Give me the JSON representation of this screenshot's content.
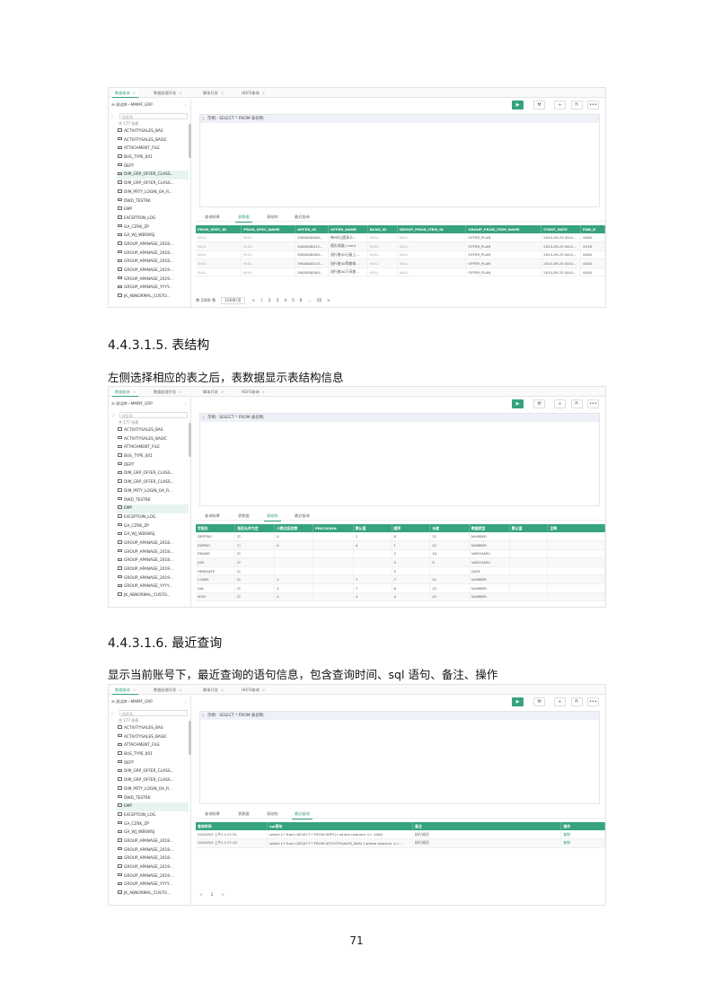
{
  "tabs": [
    {
      "label": "数据查询",
      "active": true
    },
    {
      "label": "数据处理开发",
      "active": false
    },
    {
      "label": "脚本开发",
      "active": false
    },
    {
      "label": "HDFS查询",
      "active": false
    }
  ],
  "db_select": "测试库—MMMF_GRP",
  "search_placeholder": "搜索表",
  "table_count": "共 177 张表",
  "tables": [
    "ACTIVITYSALES_BAS",
    "ACTIVITYSALES_BASIC",
    "ATTACHMENT_FILE",
    "BUS_TYPE_001",
    "DEPT",
    "DIM_GRP_OFFER_CLASS...",
    "DIM_GRP_OFFER_CLASS...",
    "DIM_PRTY_LOGIN_OA_R...",
    "DWD_TESTRK",
    "EMP",
    "EXCEPTION_LOG",
    "GA_CZRK_ZP",
    "GA_WJ_WBSWSJ",
    "GROUP_APANAGE_2018...",
    "GROUP_APANAGE_2018...",
    "GROUP_APANAGE_2018...",
    "GROUP_APANAGE_2019...",
    "GROUP_APANAGE_2019...",
    "GROUP_APANAGE_YYYY...",
    "JK_ABNORMAL_CUSTO..."
  ],
  "toolbar": {
    "run": "▶",
    "format": "⚒",
    "split": "÷",
    "export": "⇱",
    "more": "•••"
  },
  "sql_example": "示例：SELECT * FROM 表名称;",
  "line_number": "1",
  "result_tabs": [
    "查询结果",
    "表数据",
    "表结构",
    "最近查询"
  ],
  "screen1": {
    "columns": [
      "PROD_SPEC_ID",
      "PROD_SPEC_NAME",
      "OFFER_ID",
      "OFFER_NAME",
      "BLNG_ID",
      "GROUP_PROD_ITEM_ID",
      "GROUP_PROD_ITEM_NAME",
      "START_DATE",
      "END_D"
    ],
    "rows": [
      [
        "NULL",
        "NULL",
        "3400000006...",
        "神州行[提高卡...",
        "NULL",
        "NULL",
        "OFFER_PLAN",
        "2014-09-25 00:0...",
        "4000"
      ],
      [
        "NULL",
        "NULL",
        "3400000012...",
        "随实流量(.com)",
        "NULL",
        "NULL",
        "OFFER_PLAN",
        "2014-09-25 00:0...",
        "2016"
      ],
      [
        "NULL",
        "NULL",
        "3900000000...",
        "流行套40元级上...",
        "NULL",
        "NULL",
        "OFFER_PLAN",
        "2014-09-25 00:0...",
        "4000"
      ],
      [
        "NULL",
        "NULL",
        "3900000013...",
        "流行套40等套餐...",
        "NULL",
        "NULL",
        "OFFER_PLAN",
        "2014-09-25 00:0...",
        "4000"
      ],
      [
        "NULL",
        "NULL",
        "3900000000...",
        "流行套40万享套...",
        "NULL",
        "NULL",
        "OFFER_PLAN",
        "2014-09-25 00:0...",
        "4000"
      ]
    ],
    "pager": {
      "total": "共 1000 条",
      "size": "100条/页",
      "prev": "<",
      "pages": [
        "1",
        "2",
        "3",
        "4",
        "5",
        "6",
        "...",
        "10"
      ],
      "next": ">"
    }
  },
  "heading1": "4.4.3.1.5. 表结构",
  "para1": "左侧选择相应的表之后，表数据显示表结构信息",
  "screen2": {
    "columns": [
      "字段名",
      "是否允许为空",
      "小数点后位数",
      "PRECISION",
      "默认值",
      "顺序",
      "长度",
      "数据类型",
      "默认值",
      "注释"
    ],
    "rows": [
      [
        "DEPTNO",
        "☑",
        "0",
        "",
        "2",
        "8",
        "22",
        "NUMBER",
        "",
        ""
      ],
      [
        "EMPNO",
        "☐",
        "0",
        "",
        "4",
        "1",
        "22",
        "NUMBER",
        "",
        ""
      ],
      [
        "ENAME",
        "☑",
        "",
        "",
        "",
        "2",
        "10",
        "VARCHAR2",
        "",
        ""
      ],
      [
        "JOB",
        "☑",
        "",
        "",
        "",
        "3",
        "9",
        "VARCHAR2",
        "",
        ""
      ],
      [
        "HIREDATE",
        "☑",
        "",
        "",
        "",
        "5",
        "",
        "DATE",
        "",
        ""
      ],
      [
        "COMM",
        "☑",
        "2",
        "",
        "7",
        "7",
        "22",
        "NUMBER",
        "",
        ""
      ],
      [
        "SAL",
        "☑",
        "2",
        "",
        "7",
        "6",
        "22",
        "NUMBER",
        "",
        ""
      ],
      [
        "MGR",
        "☑",
        "0",
        "",
        "4",
        "4",
        "22",
        "NUMBER",
        "",
        ""
      ]
    ]
  },
  "heading2": "4.4.3.1.6. 最近查询",
  "para2": "显示当前账号下，最近查询的语句信息，包含查询时间、sql 语句、备注、操作",
  "screen3": {
    "columns": [
      "查询时间",
      "sql语句",
      "备注",
      "操作"
    ],
    "rows": [
      [
        "2020/9/3 上午11:17:31",
        "select t.* from (SELECT * FROM DEPT) t where rownum <= 1000",
        "执行成功",
        "复制"
      ],
      [
        "2020/9/3 上午11:17:10",
        "select t.* from (SELECT * FROM ACTIVITYSALES_BAS) t where rownum <=...",
        "执行成功",
        "复制"
      ]
    ],
    "pager": [
      "<",
      "1",
      ">"
    ]
  },
  "page_number": "71"
}
